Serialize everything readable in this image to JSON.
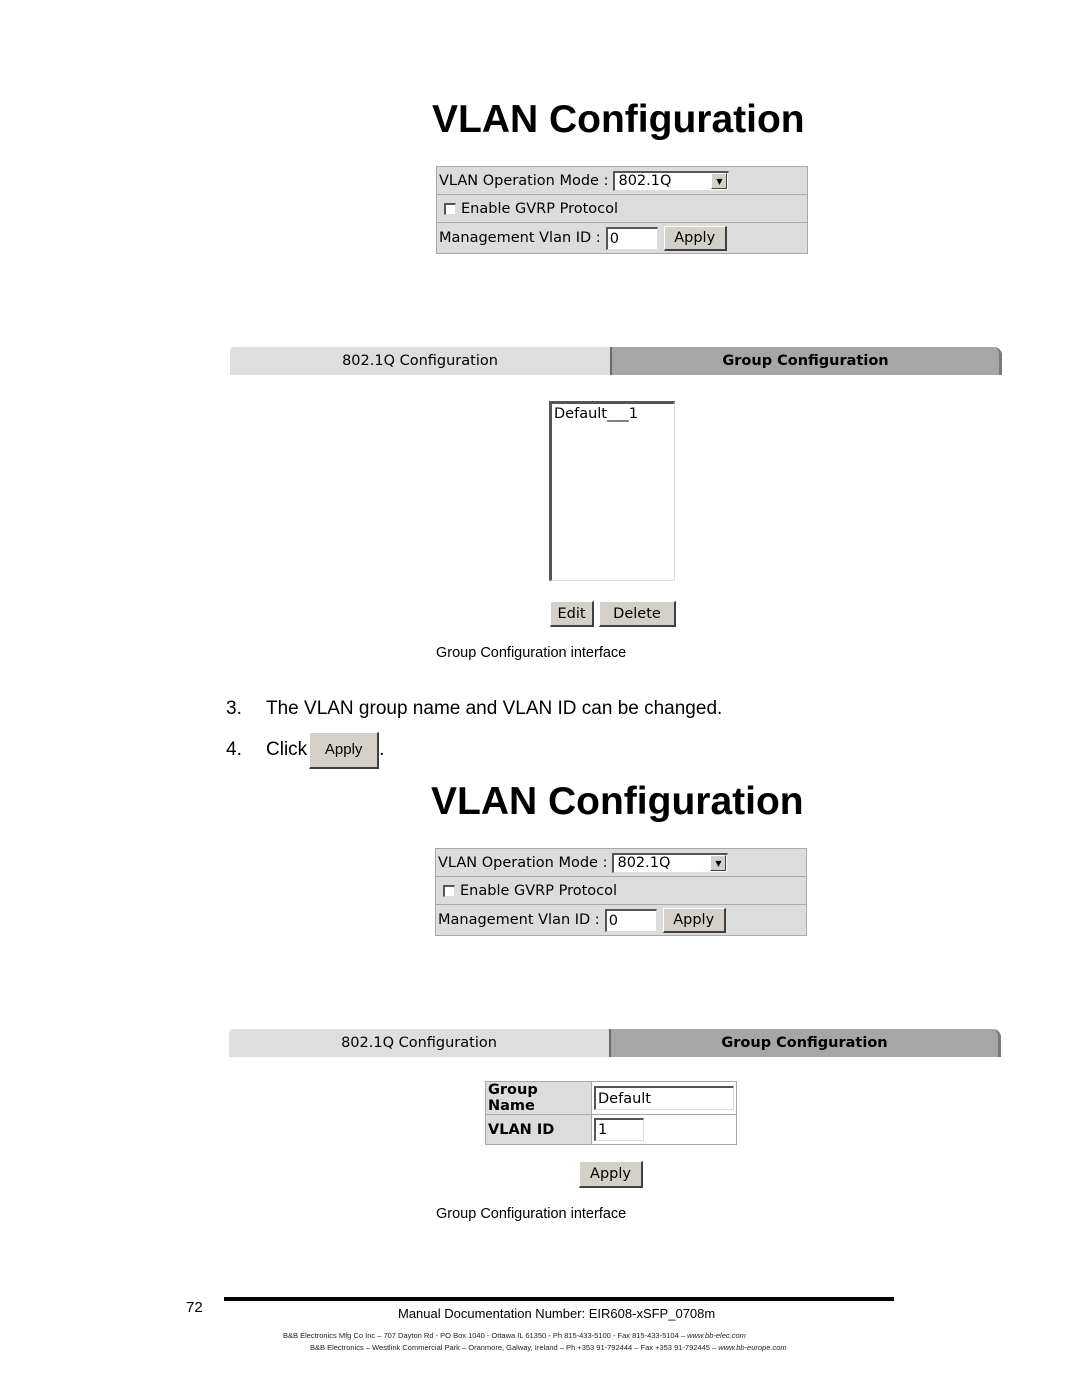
{
  "section1": {
    "title": "VLAN Configuration",
    "operation_mode_label": "VLAN Operation Mode :",
    "operation_mode_value": "802.1Q",
    "gvrp_label": "Enable GVRP Protocol",
    "gvrp_checked": false,
    "mgmt_vlan_label": "Management Vlan ID :",
    "mgmt_vlan_value": "0",
    "apply_label": "Apply"
  },
  "tabs1": {
    "tab_8021q": "802.1Q Configuration",
    "tab_group": "Group Configuration",
    "active": "Group Configuration"
  },
  "group_list": {
    "items": [
      "Default___1"
    ],
    "edit_label": "Edit",
    "delete_label": "Delete"
  },
  "caption1": "Group Configuration interface",
  "steps": [
    {
      "num": "3.",
      "text": "The VLAN group name and VLAN ID can be changed."
    },
    {
      "num": "4.",
      "text": "Click",
      "button": "Apply",
      "suffix": "."
    }
  ],
  "section2": {
    "title": "VLAN Configuration",
    "operation_mode_label": "VLAN Operation Mode :",
    "operation_mode_value": "802.1Q",
    "gvrp_label": "Enable GVRP Protocol",
    "gvrp_checked": false,
    "mgmt_vlan_label": "Management Vlan ID :",
    "mgmt_vlan_value": "0",
    "apply_label": "Apply"
  },
  "tabs2": {
    "tab_8021q": "802.1Q Configuration",
    "tab_group": "Group Configuration",
    "active": "Group Configuration"
  },
  "group_edit": {
    "group_name_label": "Group Name",
    "group_name_value": "Default",
    "vlan_id_label": "VLAN ID",
    "vlan_id_value": "1",
    "apply_label": "Apply"
  },
  "caption2": "Group Configuration interface",
  "footer": {
    "page_number": "72",
    "doc_number": "Manual Documentation Number: EIR608-xSFP_0708m",
    "address_us": "B&B Electronics Mfg Co Inc – 707 Dayton Rd - PO Box 1040 - Ottawa IL 61350 - Ph 815-433-5100 - Fax 815-433-5104 – ",
    "url_us": "www.bb-elec.com",
    "address_eu": "B&B Electronics – Westlink Commercial Park – Oranmore, Galway, Ireland – Ph +353 91-792444 – Fax +353 91-792445 – ",
    "url_eu": "www.bb-europe.com"
  }
}
